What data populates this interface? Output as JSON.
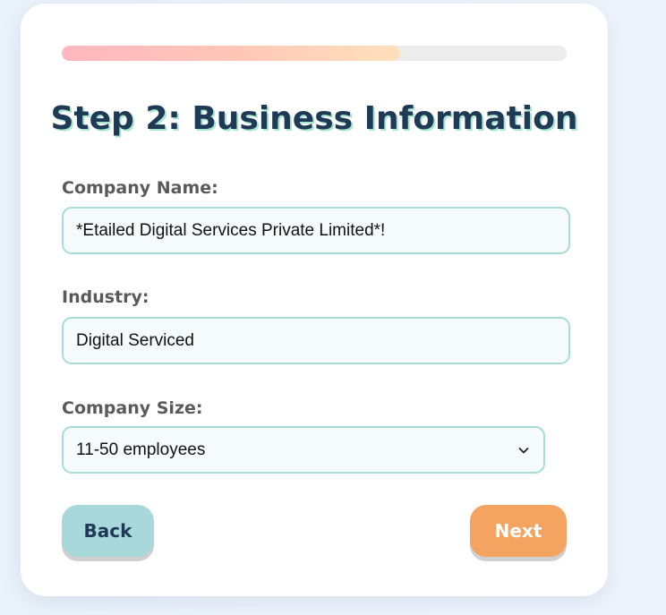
{
  "progress": {
    "value_percent": 67,
    "colors": {
      "start": "#ffb7c0",
      "end": "#ffe0bc",
      "track": "#ececec"
    }
  },
  "form": {
    "title": "Step 2: Business Information",
    "company_name": {
      "label": "Company Name:",
      "value": "*Etailed Digital Services Private Limited*!"
    },
    "industry": {
      "label": "Industry:",
      "value": "Digital Serviced"
    },
    "company_size": {
      "label": "Company Size:",
      "value": "11-50 employees"
    }
  },
  "buttons": {
    "back_label": "Back",
    "next_label": "Next"
  },
  "colors": {
    "title": "#1e3a56",
    "title_shadow": "#a8e6cf",
    "field_border": "#a8ddd6",
    "back_button": "#a8d8d9",
    "next_button": "#f4a460"
  },
  "icons": {
    "select_arrow": "chevron-down-icon"
  }
}
